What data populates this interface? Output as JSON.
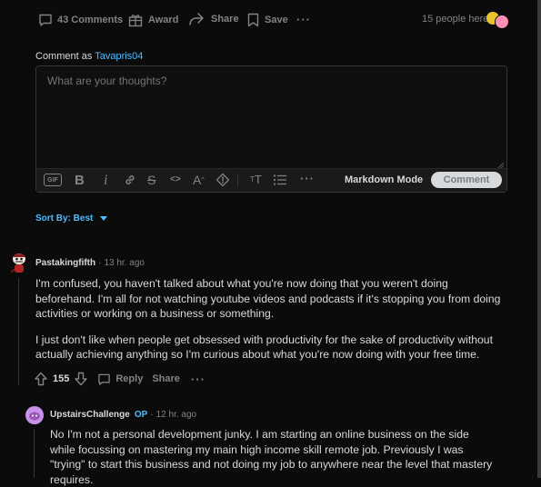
{
  "post_actions": {
    "comments_label": "43 Comments",
    "award_label": "Award",
    "share_label": "Share",
    "save_label": "Save",
    "more_label": "···",
    "people_here": "15 people here"
  },
  "comment_box": {
    "comment_as_prefix": "Comment as",
    "username": "Tavapris04",
    "placeholder": "What are your thoughts?",
    "gif_label": "GIF",
    "markdown_label": "Markdown Mode",
    "submit_label": "Comment"
  },
  "sort": {
    "label": "Sort By: Best"
  },
  "comments": [
    {
      "author": "Pastakingfifth",
      "time": "13 hr. ago",
      "paragraphs": [
        "I'm confused, you haven't talked about what you're now doing that you weren't doing beforehand. I'm all for not watching youtube videos and podcasts if it's stopping you from doing activities or working on a business or something.",
        "I just don't like when people get obsessed with productivity for the sake of productivity without actually achieving anything so I'm curious about what you're now doing with your free time."
      ],
      "votes": "155",
      "reply_label": "Reply",
      "share_label": "Share"
    },
    {
      "author": "UpstairsChallenge",
      "op_badge": "OP",
      "time": "12 hr. ago",
      "paragraphs": [
        "No I'm not a personal development junky. I am starting an online business on the side while focussing on mastering my main high income skill remote job. Previously I was \"trying\" to start this business and not doing my job to anywhere near the level that mastery requires."
      ]
    }
  ],
  "colors": {
    "background": "#0b0b0b",
    "text": "#d7dadc",
    "muted": "#818384",
    "link": "#4fbcff",
    "border": "#343536"
  }
}
